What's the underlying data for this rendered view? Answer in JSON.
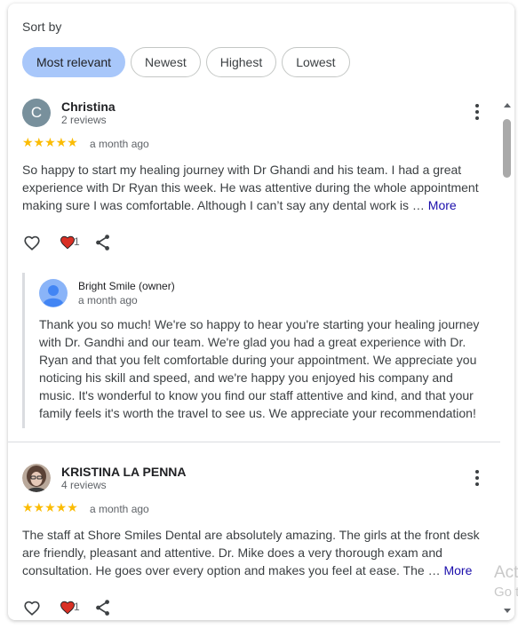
{
  "sort": {
    "label": "Sort by",
    "options": [
      "Most relevant",
      "Newest",
      "Highest",
      "Lowest"
    ],
    "selected": "Most relevant"
  },
  "reviews": [
    {
      "initial": "C",
      "avatar_color": "#78909c",
      "name": "Christina",
      "review_count": "2 reviews",
      "stars": "★★★★★",
      "rating": 5,
      "date": "a month ago",
      "text": "So happy to start my healing journey with Dr Ghandi and his team. I had a great experience with Dr Ryan this week. He was attentive during the whole appointment making sure I was comfortable. Although I can’t say any dental work is …",
      "more": "More",
      "likes": "1",
      "owner_reply": {
        "name": "Bright Smile (owner)",
        "date": "a month ago",
        "text": "Thank you so much! We're so happy to hear you're starting your healing journey with Dr. Gandhi and our team. We're glad you had a great experience with Dr. Ryan and that you felt comfortable during your appointment. We appreciate you noticing his skill and speed, and we're happy you enjoyed his company and music. It's wonderful to know you find our staff attentive and kind, and that your family feels it's worth the travel to see us. We appreciate your recommendation!"
      }
    },
    {
      "name": "KRISTINA LA PENNA",
      "review_count": "4 reviews",
      "stars": "★★★★★",
      "rating": 5,
      "date": "a month ago",
      "text": "The staff at Shore Smiles Dental are absolutely amazing. The girls at the front desk are friendly, pleasant and attentive. Dr. Mike does a very thorough exam and consultation. He goes over every option and makes you feel at ease. The …",
      "more": "More",
      "likes": "1"
    }
  ],
  "watermark": {
    "line1": "Act",
    "line2": "Go t"
  },
  "colors": {
    "chip_active": "#a8c7fa",
    "star": "#fbbc04",
    "heart": "#d93025",
    "link": "#1a0dab"
  }
}
